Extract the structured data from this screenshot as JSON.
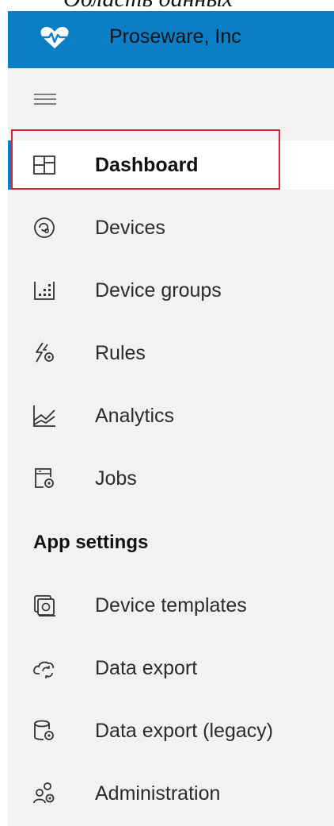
{
  "caption_text": "Область данных",
  "app": {
    "name": "Proseware, Inc",
    "logo_icon": "heart-pulse-icon",
    "header_color": "#0a7fc6"
  },
  "menu_icon": "hamburger-menu-icon",
  "nav_items": [
    {
      "label": "Dashboard",
      "icon": "dashboard-icon",
      "selected": true
    },
    {
      "label": "Devices",
      "icon": "devices-icon"
    },
    {
      "label": "Device groups",
      "icon": "device-groups-icon"
    },
    {
      "label": "Rules",
      "icon": "rules-icon"
    },
    {
      "label": "Analytics",
      "icon": "analytics-icon"
    },
    {
      "label": "Jobs",
      "icon": "jobs-icon"
    }
  ],
  "app_settings": {
    "heading": "App settings",
    "items": [
      {
        "label": "Device templates",
        "icon": "device-templates-icon"
      },
      {
        "label": "Data export",
        "icon": "data-export-icon"
      },
      {
        "label": "Data export (legacy)",
        "icon": "data-export-legacy-icon"
      },
      {
        "label": "Administration",
        "icon": "administration-icon"
      }
    ]
  },
  "highlight_color": "#d4243a"
}
